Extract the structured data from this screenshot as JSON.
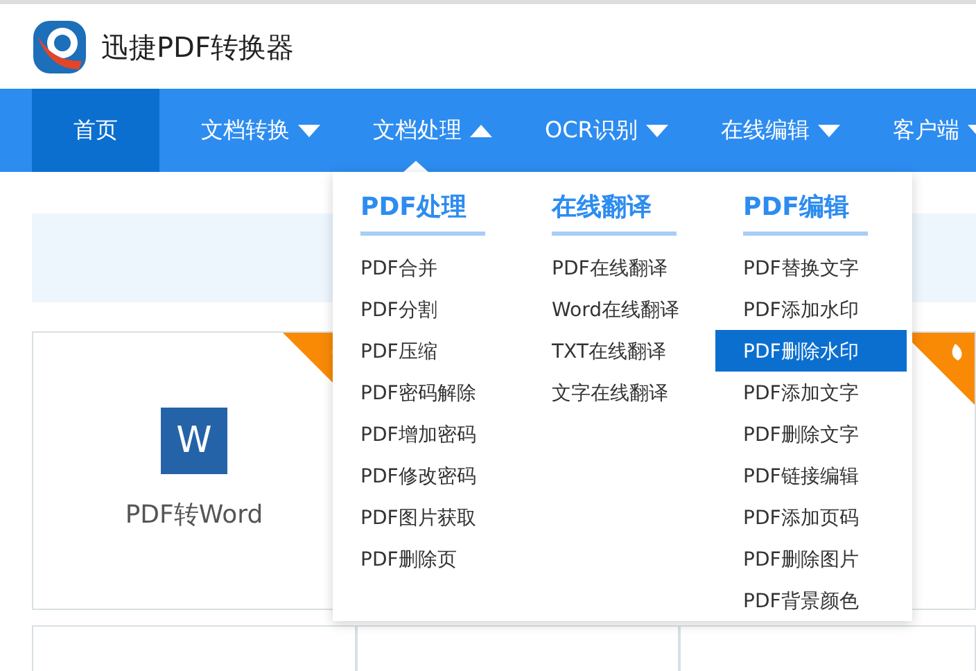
{
  "header": {
    "title": "迅捷PDF转换器"
  },
  "nav": [
    {
      "label": "首页",
      "selected": true
    },
    {
      "label": "文档转换",
      "selected": false,
      "has_menu": true,
      "expanded": false
    },
    {
      "label": "文档处理",
      "selected": false,
      "has_menu": true,
      "expanded": true
    },
    {
      "label": "OCR识别",
      "selected": false,
      "has_menu": true,
      "expanded": false
    },
    {
      "label": "在线编辑",
      "selected": false,
      "has_menu": true,
      "expanded": false
    },
    {
      "label": "客户端",
      "selected": false,
      "has_menu": true,
      "expanded": false
    }
  ],
  "dropdown": {
    "columns": [
      {
        "heading": "PDF处理",
        "items": [
          {
            "label": "PDF合并",
            "selected": false
          },
          {
            "label": "PDF分割",
            "selected": false
          },
          {
            "label": "PDF压缩",
            "selected": false
          },
          {
            "label": "PDF密码解除",
            "selected": false
          },
          {
            "label": "PDF增加密码",
            "selected": false
          },
          {
            "label": "PDF修改密码",
            "selected": false
          },
          {
            "label": "PDF图片获取",
            "selected": false
          },
          {
            "label": "PDF删除页",
            "selected": false
          }
        ]
      },
      {
        "heading": "在线翻译",
        "items": [
          {
            "label": "PDF在线翻译",
            "selected": false
          },
          {
            "label": "Word在线翻译",
            "selected": false
          },
          {
            "label": "TXT在线翻译",
            "selected": false
          },
          {
            "label": "文字在线翻译",
            "selected": false
          }
        ]
      },
      {
        "heading": "PDF编辑",
        "items": [
          {
            "label": "PDF替换文字",
            "selected": false
          },
          {
            "label": "PDF添加水印",
            "selected": false
          },
          {
            "label": "PDF删除水印",
            "selected": true
          },
          {
            "label": "PDF添加文字",
            "selected": false
          },
          {
            "label": "PDF删除文字",
            "selected": false
          },
          {
            "label": "PDF链接编辑",
            "selected": false
          },
          {
            "label": "PDF添加页码",
            "selected": false
          },
          {
            "label": "PDF删除图片",
            "selected": false
          },
          {
            "label": "PDF背景颜色",
            "selected": false
          }
        ]
      }
    ]
  },
  "cards": [
    {
      "label": "PDF转Word",
      "icon_letter": "W",
      "hot": true
    },
    {
      "hot": true
    }
  ]
}
